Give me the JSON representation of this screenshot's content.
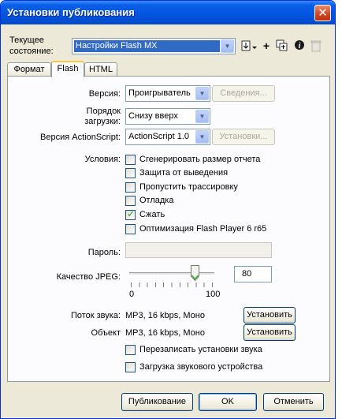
{
  "window": {
    "title": "Установки публикования",
    "close_glyph": "✕"
  },
  "profile": {
    "label_line1": "Текущее",
    "label_line2": "состояние:",
    "selected": "Настройки Flash MX",
    "toolbar_icons": [
      "import-export-icon",
      "add-icon",
      "duplicate-icon",
      "info-icon",
      "delete-icon"
    ]
  },
  "tabs": [
    {
      "label": "Формат",
      "active": false
    },
    {
      "label": "Flash",
      "active": true
    },
    {
      "label": "HTML",
      "active": false
    }
  ],
  "flash": {
    "version": {
      "label": "Версия:",
      "value": "Проигрыватель",
      "button": "Сведения..."
    },
    "load_order": {
      "label_line1": "Порядок",
      "label_line2": "загрузки:",
      "value": "Снизу вверх"
    },
    "as_version": {
      "label": "Версия ActionScript:",
      "value": "ActionScript 1.0",
      "button": "Установки..."
    },
    "conditions": {
      "label": "Условия:",
      "options": [
        {
          "label": "Сгенерировать размер отчета",
          "checked": false
        },
        {
          "label": "Защита от выведения",
          "checked": false
        },
        {
          "label": "Пропустить трассировку",
          "checked": false
        },
        {
          "label": "Отладка",
          "checked": false
        },
        {
          "label": "Сжать",
          "checked": true
        },
        {
          "label": "Оптимизация Flash Player 6 r65",
          "checked": false
        }
      ]
    },
    "password": {
      "label": "Пароль:",
      "value": ""
    },
    "jpeg": {
      "label": "Качество JPEG:",
      "value": "80",
      "min": "0",
      "max": "100",
      "level": 0.8
    },
    "audio_stream": {
      "label": "Поток звука:",
      "value": "MP3, 16 kbps, Моно",
      "button": "Установить"
    },
    "audio_event": {
      "label": "Объект",
      "value": "MP3, 16 kbps, Моно",
      "button": "Установить"
    },
    "audio_options": [
      {
        "label": "Перезаписать установки звука",
        "checked": false
      },
      {
        "label": "Загрузка звукового устройства",
        "checked": false
      }
    ]
  },
  "footer": {
    "publish": "Публикование",
    "ok": "OK",
    "cancel": "Отменить"
  },
  "colors": {
    "title_bar": "#0355e0",
    "dialog_bg": "#ece9d8",
    "selection": "#316ac5",
    "check": "#21a121"
  }
}
